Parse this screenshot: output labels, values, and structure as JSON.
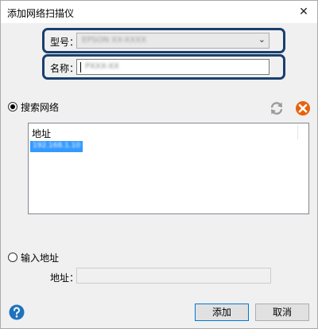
{
  "window": {
    "title": "添加网络扫描仪",
    "close_glyph": "✕"
  },
  "form": {
    "model_label": "型号：",
    "model_value": "EPSON XX-XXXX",
    "model_arrow": "⌄",
    "name_label": "名称：",
    "name_value": "PXXX-XX"
  },
  "search_network": {
    "label": "搜索网络",
    "selected": true,
    "list_header": "地址",
    "rows": [
      {
        "address": "192.168.1.10"
      }
    ]
  },
  "manual_address": {
    "label": "输入地址",
    "selected": false,
    "address_label": "地址：",
    "address_value": ""
  },
  "buttons": {
    "add": "添加",
    "cancel": "取消"
  },
  "icons": {
    "refresh": "refresh-icon",
    "cancel_search": "cancel-x-icon",
    "help": "help-icon"
  },
  "colors": {
    "highlight_border": "#1a3f6e",
    "selection": "#3399ff",
    "cancel_icon": "#e8620c",
    "help_icon": "#1e73be"
  }
}
